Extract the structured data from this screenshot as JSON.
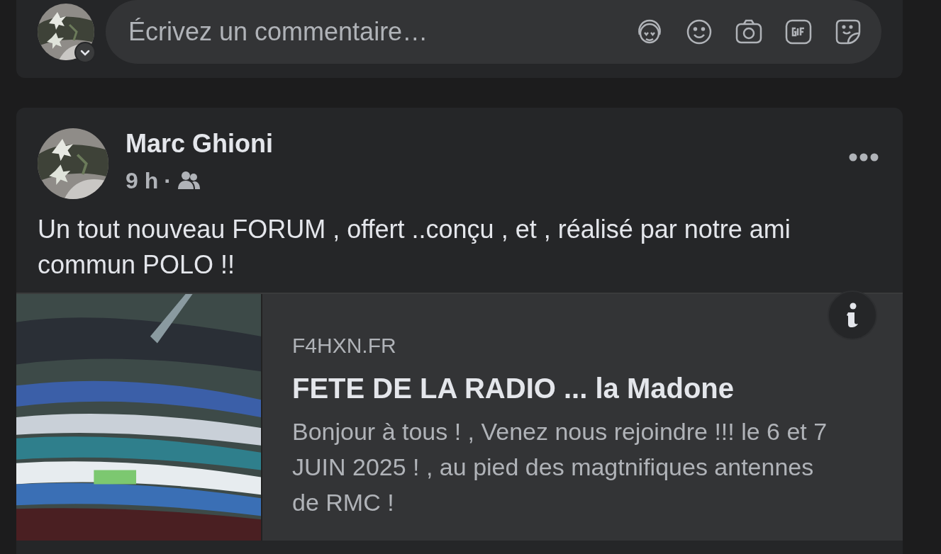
{
  "comment_box": {
    "placeholder": "Écrivez un commentaire…"
  },
  "post": {
    "author": "Marc Ghioni",
    "time": "9 h",
    "separator": "·",
    "text": "Un tout nouveau FORUM , offert ..conçu , et , réalisé par notre ami commun POLO !!",
    "link_preview": {
      "domain": "F4HXN.FR",
      "title": "FETE DE LA RADIO ... la Madone",
      "description": "Bonjour à tous ! , Venez nous rejoindre !!! le 6 et 7 JUIN 2025 ! , au pied des magtnifiques antennes de RMC !"
    }
  }
}
